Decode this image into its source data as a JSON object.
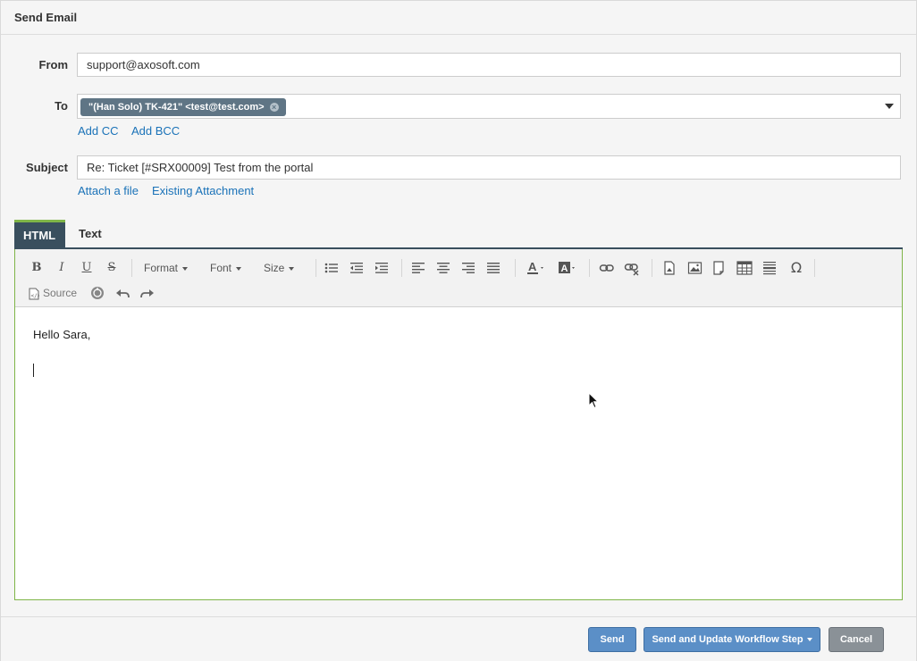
{
  "window": {
    "title": "Send Email"
  },
  "form": {
    "from": {
      "label": "From",
      "value": "support@axosoft.com"
    },
    "to": {
      "label": "To",
      "recipients": [
        "\"(Han Solo) TK-421\" <test@test.com>"
      ]
    },
    "add_cc": "Add CC",
    "add_bcc": "Add BCC",
    "subject": {
      "label": "Subject",
      "value": "Re: Ticket [#SRX00009] Test from the portal"
    },
    "attach_file": "Attach a file",
    "existing_attachment": "Existing Attachment"
  },
  "tabs": [
    {
      "label": "HTML",
      "active": true
    },
    {
      "label": "Text",
      "active": false
    }
  ],
  "toolbar": {
    "format_label": "Format",
    "font_label": "Font",
    "size_label": "Size",
    "source_label": "Source",
    "buttons": [
      "bold-icon",
      "italic-icon",
      "underline-icon",
      "strikethrough-icon",
      "bullet-list-icon",
      "outdent-icon",
      "indent-icon",
      "align-left-icon",
      "align-center-icon",
      "align-right-icon",
      "align-justify-icon",
      "text-color-icon",
      "background-color-icon",
      "link-icon",
      "unlink-icon",
      "insert-file-icon",
      "image-icon",
      "page-icon",
      "table-icon",
      "horizontal-line-icon",
      "special-char-icon",
      "source-icon",
      "spellcheck-icon",
      "undo-icon",
      "redo-icon"
    ]
  },
  "editor": {
    "greeting": "Hello Sara,"
  },
  "footer": {
    "send_label": "Send",
    "send_update_label": "Send and Update Workflow Step",
    "cancel_label": "Cancel"
  },
  "colors": {
    "accent_green": "#7fb548",
    "tab_dark": "#394f5e",
    "link_blue": "#1a72b8",
    "button_blue": "#5b8fc7",
    "chip_gray": "#5f7585"
  }
}
